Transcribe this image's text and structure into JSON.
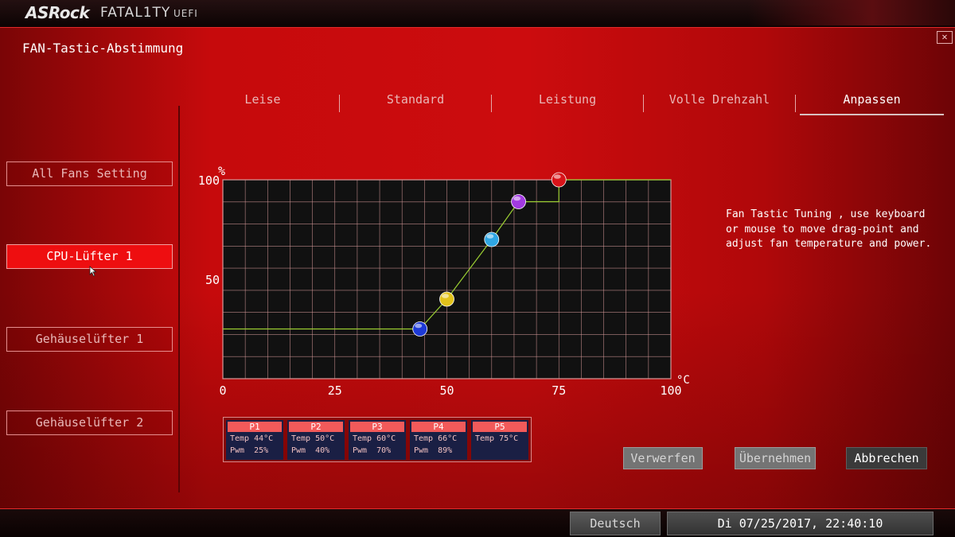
{
  "brand": {
    "name": "ASRock",
    "series": "FATAL1TY",
    "firmware": "UEFI"
  },
  "page": {
    "title": "FAN-Tastic-Abstimmung",
    "close_symbol": "✕"
  },
  "sidebar": {
    "items": [
      {
        "label": "All Fans Setting",
        "active": false
      },
      {
        "label": "CPU-Lüfter 1",
        "active": true
      },
      {
        "label": "Gehäuselüfter 1",
        "active": false
      },
      {
        "label": "Gehäuselüfter 2",
        "active": false
      }
    ]
  },
  "tabs": [
    {
      "label": "Leise",
      "active": false
    },
    {
      "label": "Standard",
      "active": false
    },
    {
      "label": "Leistung",
      "active": false
    },
    {
      "label": "Volle Drehzahl",
      "active": false
    },
    {
      "label": "Anpassen",
      "active": true
    }
  ],
  "chart_data": {
    "type": "line",
    "ylabel": "%",
    "xlabel": "°C",
    "xlim": [
      0,
      100
    ],
    "ylim": [
      0,
      100
    ],
    "x_ticks": [
      "0",
      "25",
      "50",
      "75",
      "100"
    ],
    "y_ticks": [
      "100",
      "50"
    ],
    "grid": true,
    "colors": {
      "background": "#111111",
      "grid": "#d89a9a",
      "line": "#9acd32"
    },
    "baseline_pwm": 25,
    "points": [
      {
        "name": "P1",
        "temp": 44,
        "pwm": 25,
        "color": "#1e3ad6"
      },
      {
        "name": "P2",
        "temp": 50,
        "pwm": 40,
        "color": "#e2c21b"
      },
      {
        "name": "P3",
        "temp": 60,
        "pwm": 70,
        "color": "#2fa6e3"
      },
      {
        "name": "P4",
        "temp": 66,
        "pwm": 89,
        "color": "#a23ae0"
      },
      {
        "name": "P5",
        "temp": 75,
        "pwm": 100,
        "color": "#d8141a"
      }
    ]
  },
  "points_table": [
    {
      "name": "P1",
      "temp": "Temp 44°C",
      "pwm": "Pwm  25%"
    },
    {
      "name": "P2",
      "temp": "Temp 50°C",
      "pwm": "Pwm  40%"
    },
    {
      "name": "P3",
      "temp": "Temp 60°C",
      "pwm": "Pwm  70%"
    },
    {
      "name": "P4",
      "temp": "Temp 66°C",
      "pwm": "Pwm  89%"
    },
    {
      "name": "P5",
      "temp": "Temp 75°C",
      "pwm": ""
    }
  ],
  "help": {
    "text": "Fan Tastic Tuning , use keyboard or mouse to move drag-point and adjust fan temperature and power."
  },
  "actions": {
    "discard": "Verwerfen",
    "apply": "Übernehmen",
    "cancel": "Abbrechen"
  },
  "footer": {
    "language": "Deutsch",
    "datetime": "Di 07/25/2017, 22:40:10"
  }
}
